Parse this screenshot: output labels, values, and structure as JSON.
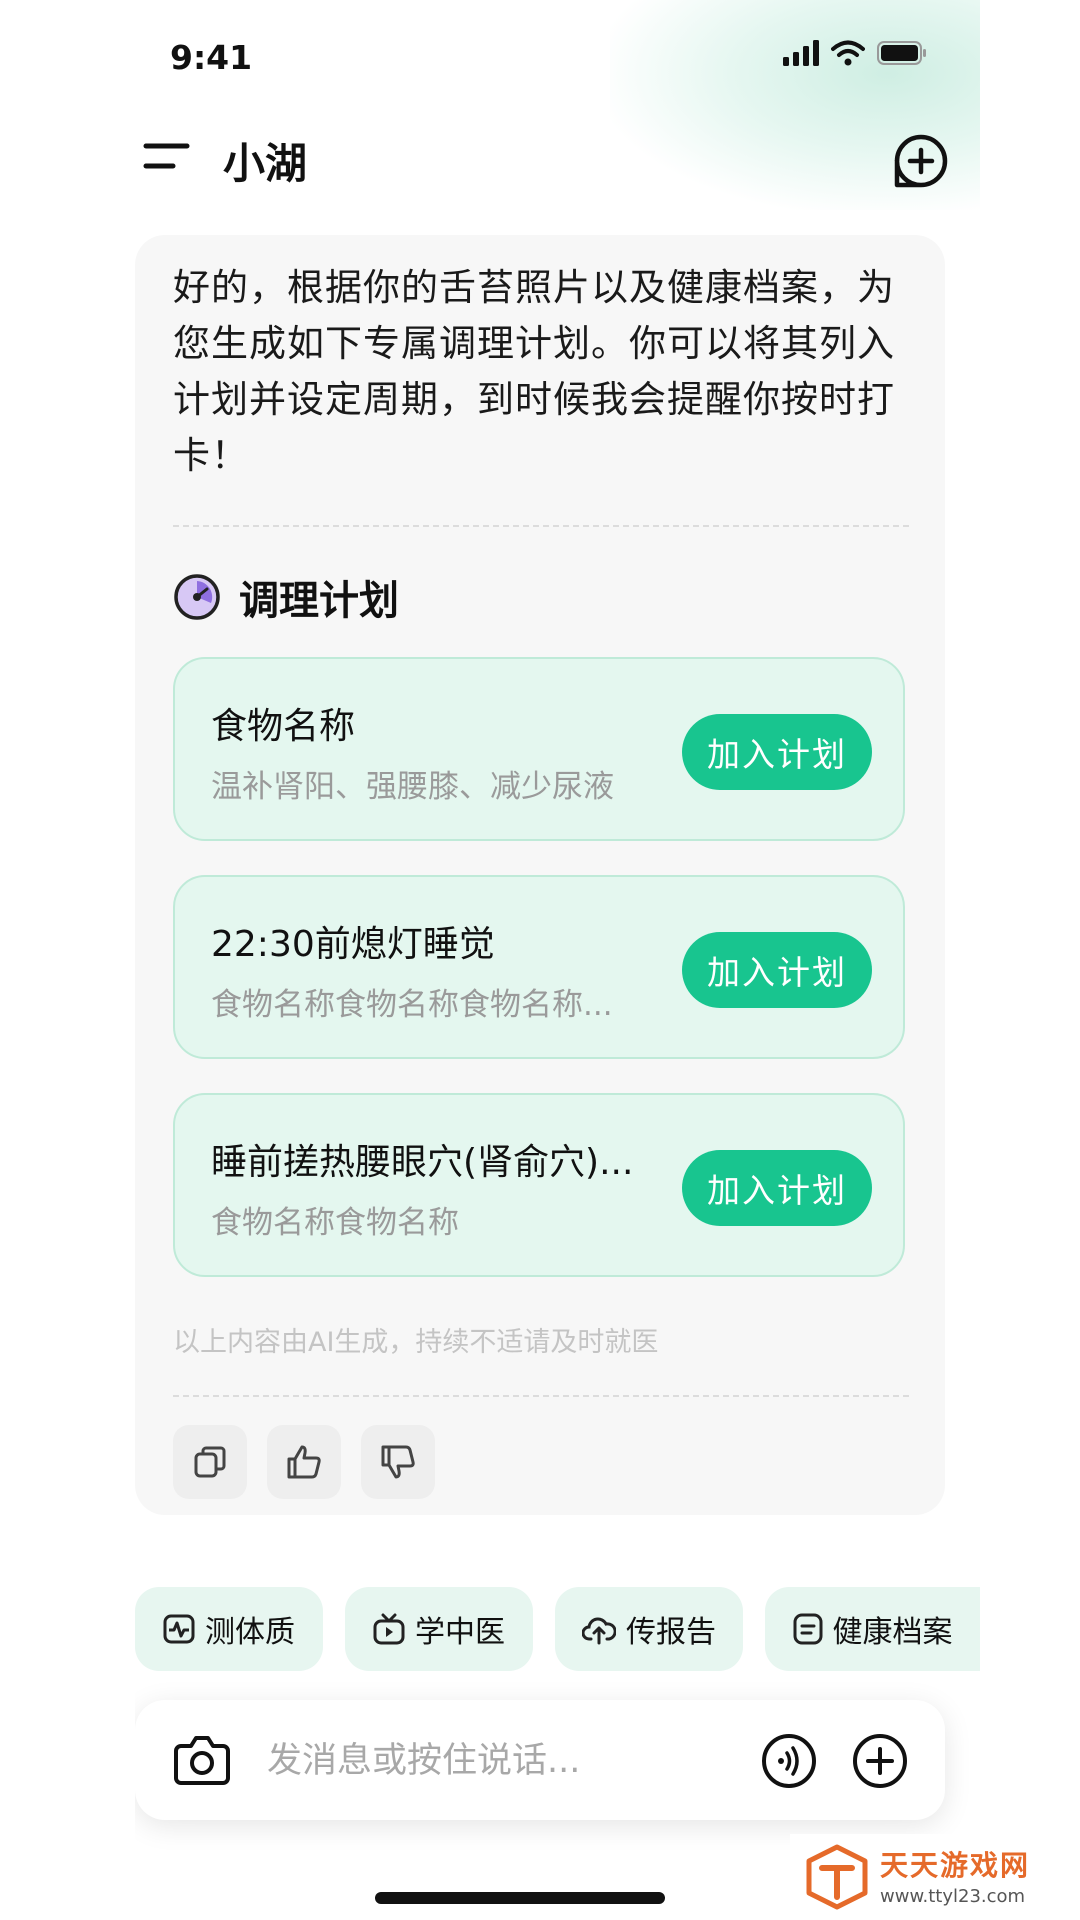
{
  "status_bar": {
    "time": "9:41"
  },
  "header": {
    "title": "小湖"
  },
  "message": {
    "text": "好的，根据你的舌苔照片以及健康档案，为您生成如下专属调理计划。你可以将其列入计划并设定周期，到时候我会提醒你按时打卡！",
    "plan_heading": "调理计划",
    "plans": [
      {
        "title": "食物名称",
        "subtitle": "温补肾阳、强腰膝、减少尿液",
        "button": "加入计划"
      },
      {
        "title": "22:30前熄灯睡觉",
        "subtitle": "食物名称食物名称食物名称...",
        "button": "加入计划"
      },
      {
        "title": "睡前搓热腰眼穴(肾俞穴)...",
        "subtitle": "食物名称食物名称",
        "button": "加入计划"
      }
    ],
    "disclaimer": "以上内容由AI生成，持续不适请及时就医"
  },
  "quick_actions": [
    {
      "label": "测体质",
      "icon": "pulse-icon"
    },
    {
      "label": "学中医",
      "icon": "tv-icon"
    },
    {
      "label": "传报告",
      "icon": "cloud-upload-icon"
    },
    {
      "label": "健康档案",
      "icon": "document-icon"
    }
  ],
  "input": {
    "placeholder": "发消息或按住说话..."
  },
  "watermark": {
    "title": "天天游戏网",
    "url": "www.ttyl23.com"
  },
  "colors": {
    "accent": "#18c58f",
    "card_bg": "#e4f7ef",
    "chip_bg": "#e7f6f0"
  }
}
